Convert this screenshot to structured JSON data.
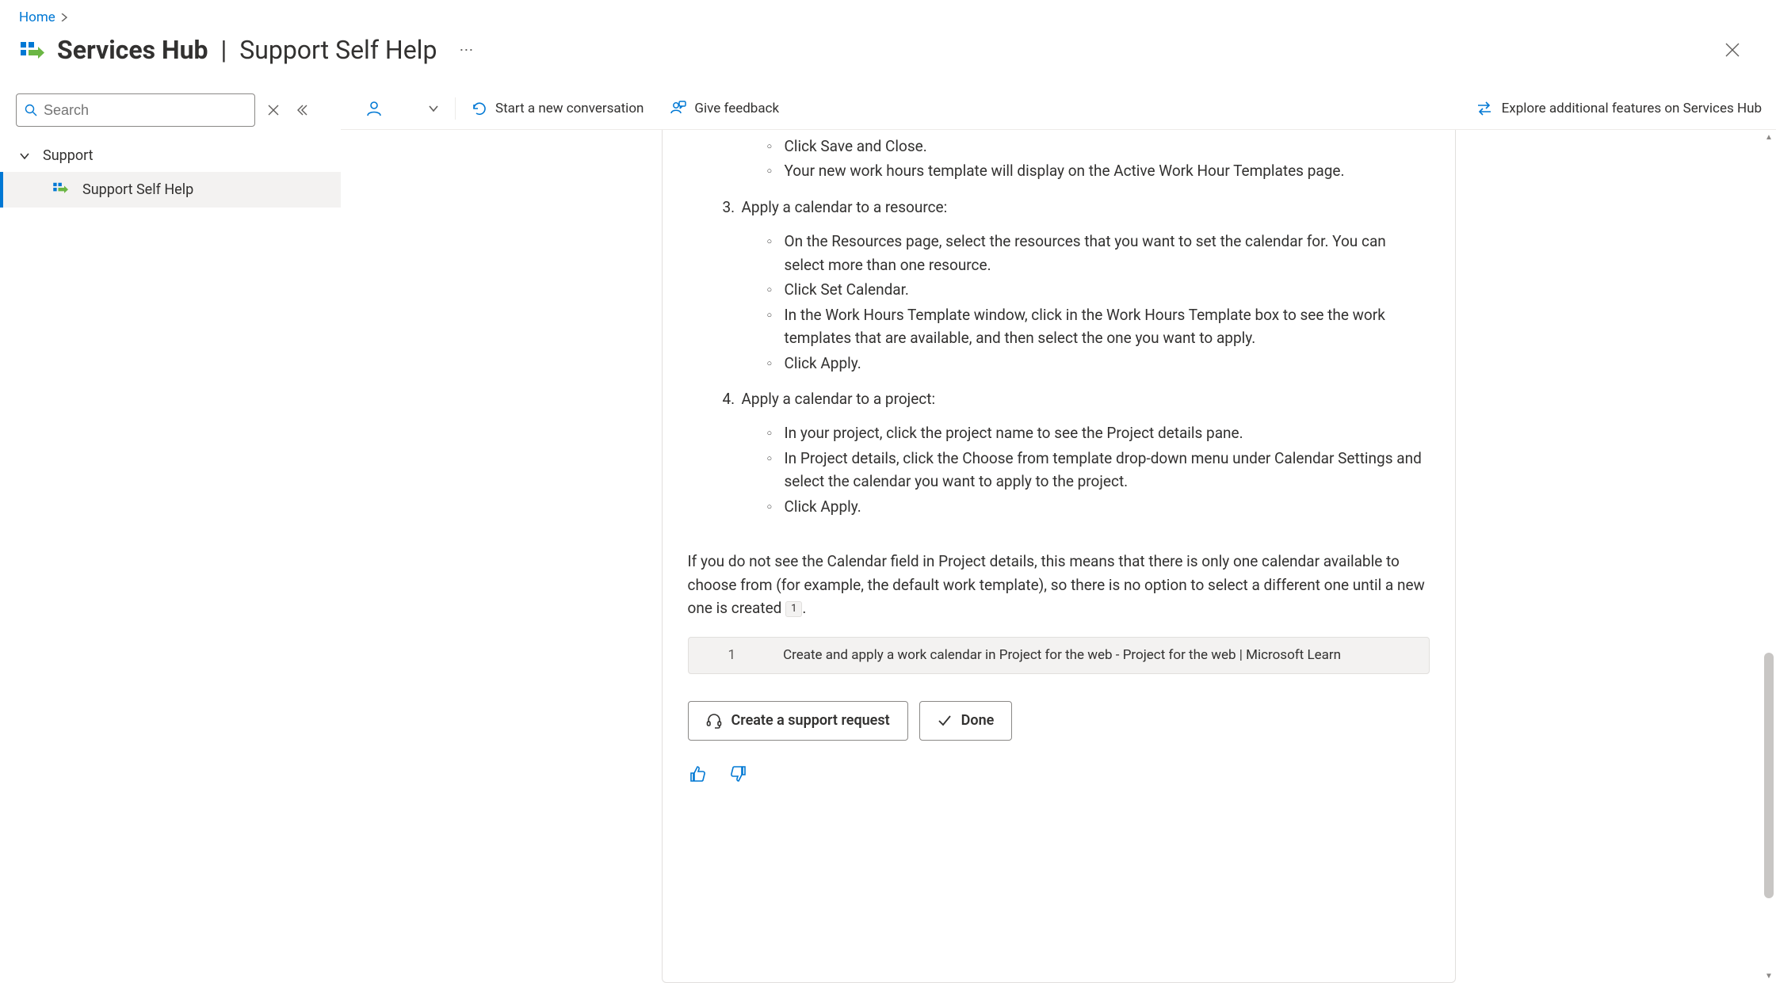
{
  "breadcrumb": {
    "home": "Home"
  },
  "header": {
    "app_name_strong": "Services Hub",
    "app_name_suffix": "Support Self Help"
  },
  "sidebar": {
    "search_placeholder": "Search",
    "group_label": "Support",
    "child_label": "Support Self Help"
  },
  "toolbar": {
    "start_conversation": "Start a new conversation",
    "give_feedback": "Give feedback",
    "explore": "Explore additional features on Services Hub"
  },
  "answer": {
    "pre_bullets": {
      "b1": "Click Save and Close.",
      "b2": "Your new work hours template will display on the Active Work Hour Templates page."
    },
    "step3": {
      "number": "3.",
      "title": "Apply a calendar to a resource:",
      "b1": "On the Resources page, select the resources that you want to set the calendar for. You can select more than one resource.",
      "b2": "Click Set Calendar.",
      "b3": "In the Work Hours Template window, click in the Work Hours Template box to see the work templates that are available, and then select the one you want to apply.",
      "b4": "Click Apply."
    },
    "step4": {
      "number": "4.",
      "title": "Apply a calendar to a project:",
      "b1": "In your project, click the project name to see the Project details pane.",
      "b2": "In Project details, click the Choose from template drop-down menu under Calendar Settings and select the calendar you want to apply to the project.",
      "b3": "Click Apply."
    },
    "paragraph": "If you do not see the Calendar field in Project details, this means that there is only one calendar available to choose from (for example, the default work template), so there is no option to select a different one until a new one is created",
    "inline_ref": "1",
    "paragraph_period": ".",
    "reference": {
      "num": "1",
      "text": "Create and apply a work calendar in Project for the web - Project for the web | Microsoft Learn"
    },
    "actions": {
      "create": "Create a support request",
      "done": "Done"
    }
  }
}
